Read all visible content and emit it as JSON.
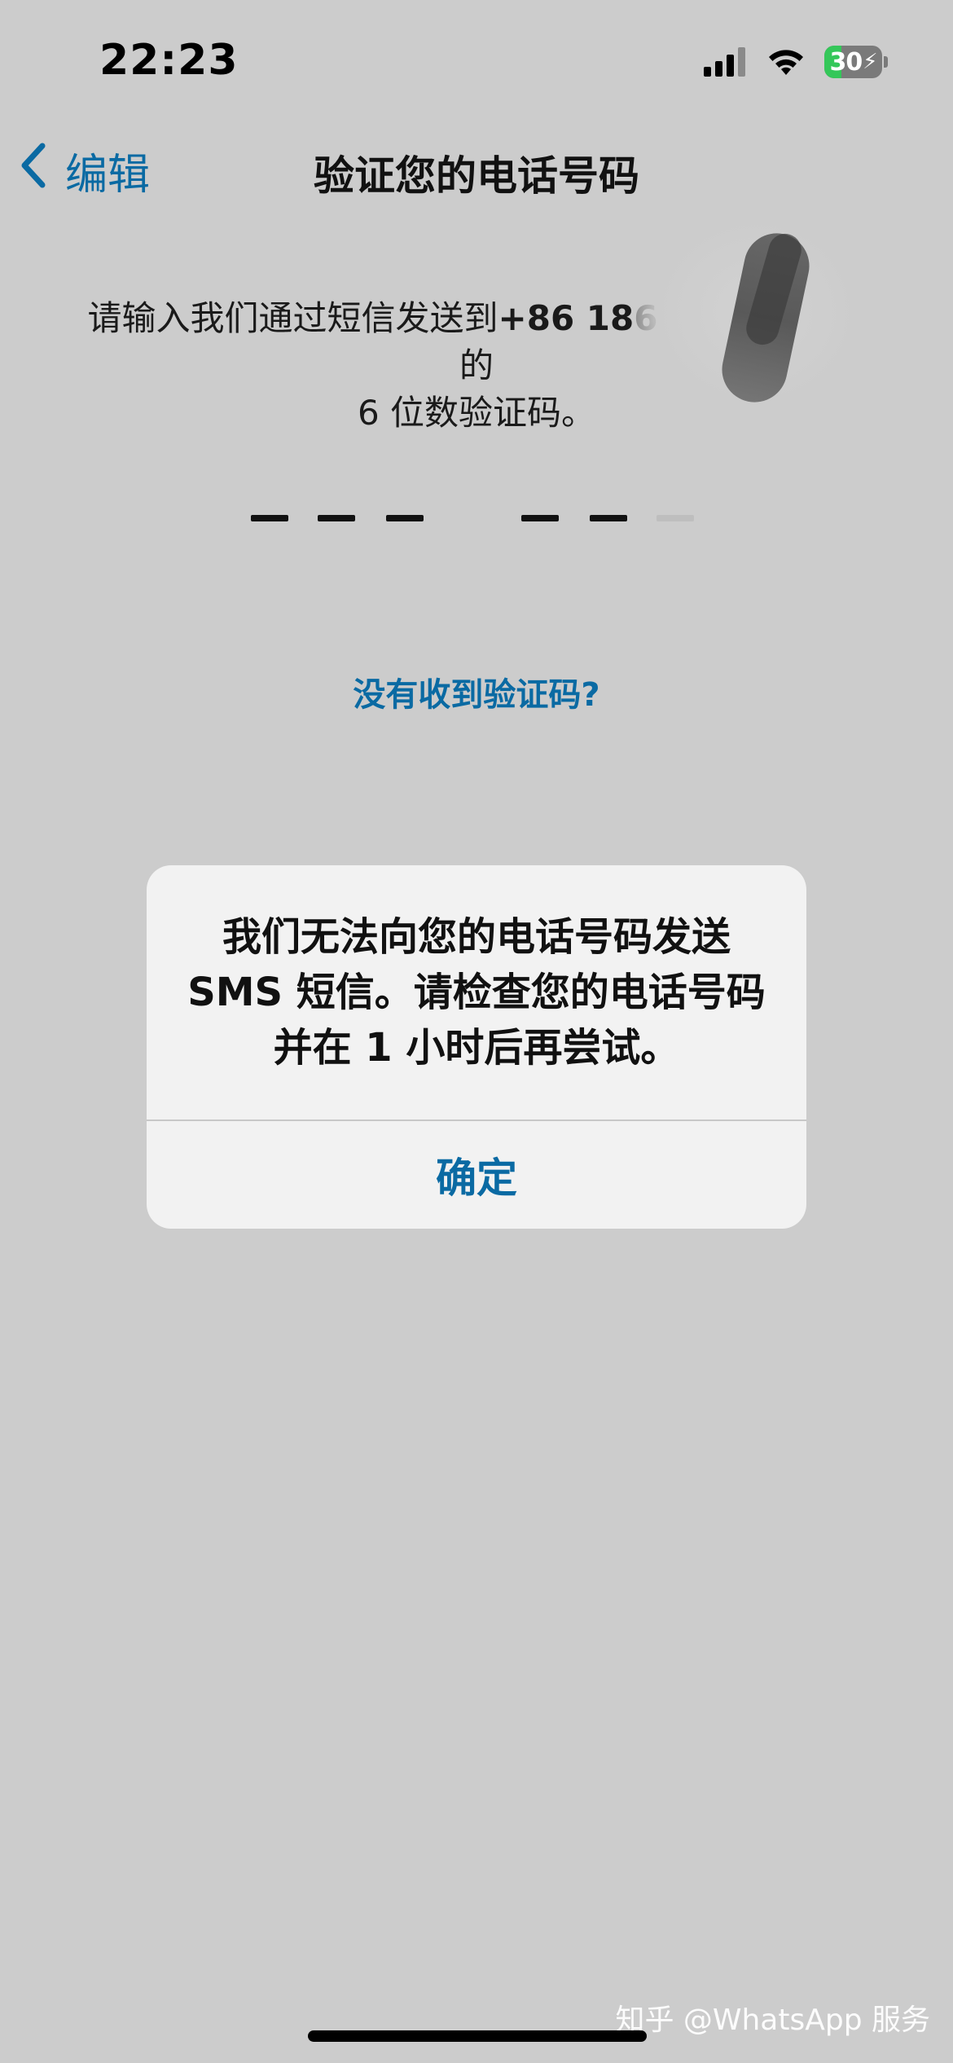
{
  "status_bar": {
    "time": "22:23",
    "battery_level": "30",
    "battery_fraction": 0.3,
    "icons": [
      "signal-icon",
      "wifi-icon",
      "battery-charging-icon"
    ]
  },
  "nav": {
    "back_label": "编辑",
    "title": "验证您的电话号码"
  },
  "instruction": {
    "line1_prefix": "请输入我们通过短信发送到",
    "phone_visible": "+86 186",
    "line1_suffix": "的",
    "line2": "6 位数验证码。"
  },
  "code_input": {
    "digit_count": 6,
    "entered": ""
  },
  "resend": {
    "label": "没有收到验证码?"
  },
  "alert": {
    "message": "我们无法向您的电话号码发送 SMS 短信。请检查您的电话号码并在 1 小时后再尝试。",
    "button": "确定"
  },
  "watermark": {
    "text": "知乎 @WhatsApp 服务"
  },
  "colors": {
    "background": "#cccccc",
    "accent": "#0a6aa3",
    "alert_bg": "#f2f2f2",
    "battery_green": "#34c759"
  }
}
